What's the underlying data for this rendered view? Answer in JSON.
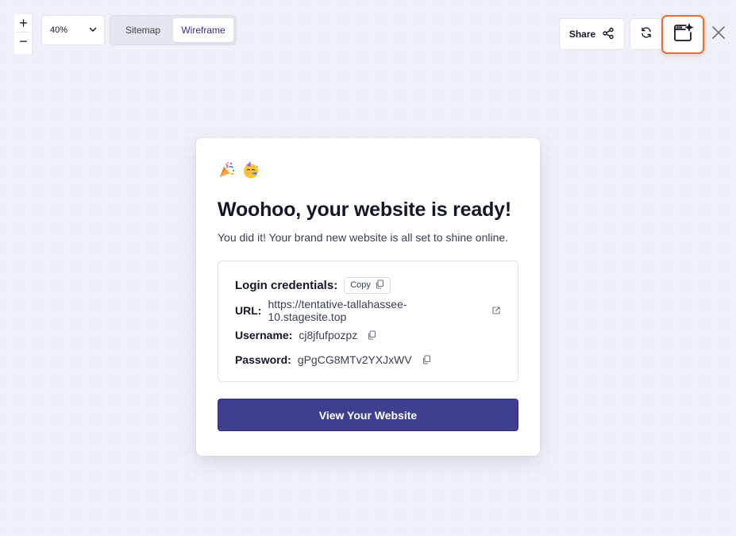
{
  "zoom": {
    "plus": "+",
    "minus": "−",
    "level": "40%"
  },
  "view_modes": {
    "sitemap": "Sitemap",
    "wireframe": "Wireframe",
    "active": "Wireframe"
  },
  "toolbar": {
    "share_label": "Share",
    "icons": [
      "share-icon",
      "refresh-icon",
      "ai-browser-icon",
      "close-icon"
    ],
    "ai_button_border_color": "#ef6c2f"
  },
  "card": {
    "emojis": [
      "party-popper-icon",
      "party-face-icon"
    ],
    "title": "Woohoo, your website is ready!",
    "subtitle": "You did it! Your brand new website is all set to shine online.",
    "credentials": {
      "heading": "Login credentials:",
      "copy_label": "Copy",
      "url_label": "URL:",
      "url_value": "https://tentative-tallahassee-10.stagesite.top",
      "username_label": "Username:",
      "username_value": "cj8jfufpozpz",
      "password_label": "Password:",
      "password_value": "gPgCG8MTv2YXJxWV"
    },
    "cta_label": "View Your Website",
    "cta_color": "#3e3f8e"
  }
}
